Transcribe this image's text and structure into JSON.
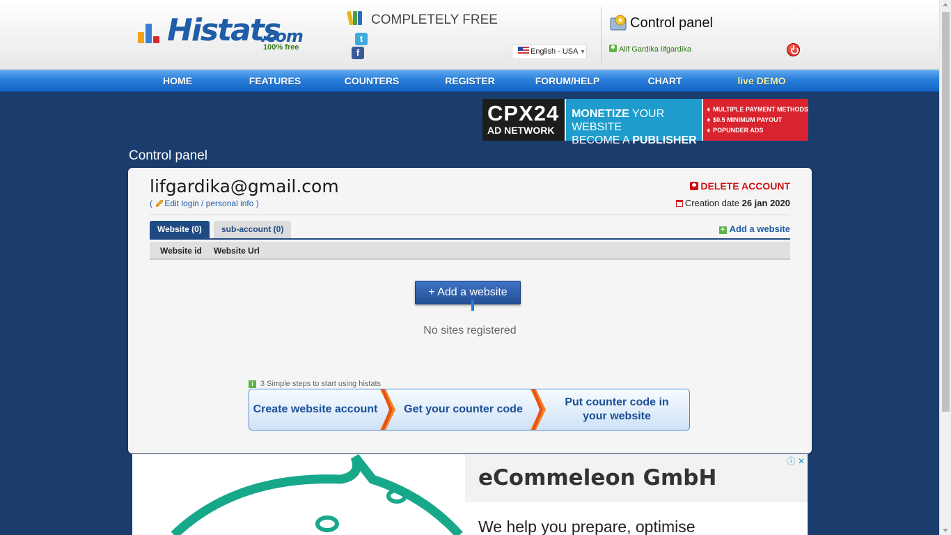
{
  "header": {
    "logo_text": "Histats",
    "logo_domain": ".com",
    "logo_tagline": "100% free",
    "free_banner": "COMPLETELY FREE",
    "language": "English - USA",
    "panel_title": "Control panel",
    "user_name": "Alif Gardika lifgardika"
  },
  "nav": {
    "items": [
      "HOME",
      "FEATURES",
      "COUNTERS",
      "REGISTER",
      "FORUM/HELP",
      "CHART",
      "live DEMO"
    ]
  },
  "top_ad": {
    "brand": "CPX24",
    "brand_sub": "AD NETWORK",
    "line1_bold": "MONETIZE",
    "line1_rest": " YOUR WEBSITE",
    "line2_rest": "BECOME A ",
    "line2_bold": "PUBLISHER",
    "bullets": [
      "MULTIPLE PAYMENT METHODS",
      "$0.5 MINIMUM PAYOUT",
      "POPUNDER ADS"
    ]
  },
  "page": {
    "section_title": "Control panel",
    "email": "lifgardika@gmail.com",
    "edit_prefix": "(",
    "edit_label": "Edit login / personal info",
    "edit_suffix": ")",
    "delete_label": "DELETE ACCOUNT",
    "creation_label": "Creation date",
    "creation_date": "26 jan 2020",
    "tabs": [
      {
        "label": "Website (0)",
        "active": true
      },
      {
        "label": "sub-account (0)",
        "active": false
      }
    ],
    "add_website_link": "Add a website",
    "columns": [
      "Website id",
      "Website Url"
    ],
    "add_button": "+ Add a website",
    "empty_text": "No sites registered",
    "steps_title": "3 Simple steps to start using histats",
    "steps": [
      "Create website account",
      "Get your counter code",
      "Put counter code in your website"
    ]
  },
  "bottom_ad": {
    "company": "eCommeleon GmbH",
    "tagline": "We help you prepare, optimise",
    "choices": "ⓘ ✕"
  },
  "colors": {
    "nav_blue": "#2a7fdb",
    "page_bg": "#1a3d6d",
    "link_blue": "#1f5da8",
    "danger_red": "#cf1010",
    "accent_green": "#5cb545"
  }
}
